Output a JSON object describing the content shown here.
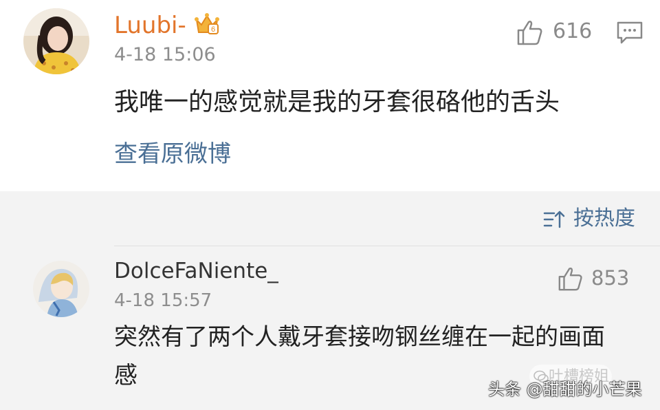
{
  "post": {
    "username": "Luubi-",
    "badge_icon": "crown-badge-icon",
    "timestamp": "4-18 15:06",
    "like_count": "616",
    "text": "我唯一的感觉就是我的牙套很硌他的舌头",
    "view_original_label": "查看原微博",
    "username_color": "#e2752b"
  },
  "sort": {
    "label": "按热度",
    "icon": "sort-icon"
  },
  "comments": [
    {
      "username": "DolceFaNiente_",
      "timestamp": "4-18 15:57",
      "like_count": "853",
      "text": "突然有了两个人戴牙套接吻钢丝缠在一起的画面感"
    }
  ],
  "watermark": {
    "primary": "头条 @甜甜的小芒果",
    "secondary": "吐槽榜姐"
  }
}
